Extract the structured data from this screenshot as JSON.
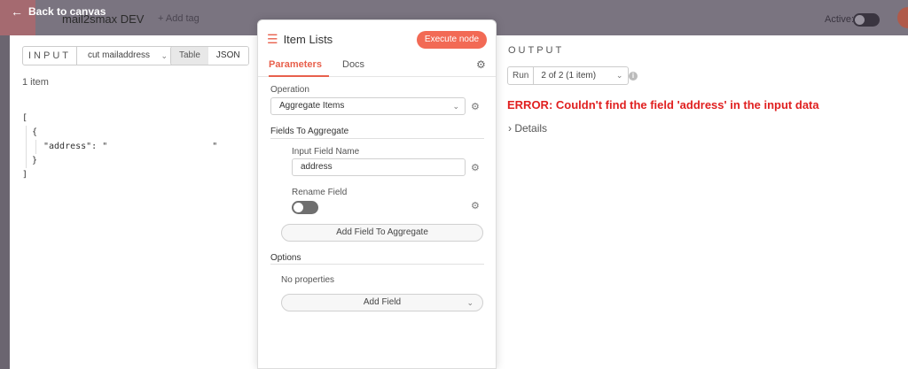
{
  "topbar": {
    "back_label": "Back to canvas",
    "workflow_name": "mail2smax DEV",
    "add_tag_label": "+ Add tag",
    "active_label": "Active:"
  },
  "input": {
    "label": "INPUT",
    "source_node": "cut mailaddress",
    "view_table": "Table",
    "view_json": "JSON",
    "active_view": "JSON",
    "item_count": "1 item",
    "json_key": "\"address\": \"",
    "json_value_end": "\""
  },
  "node": {
    "title": "Item Lists",
    "execute_label": "Execute node",
    "tabs": [
      "Parameters",
      "Docs"
    ],
    "active_tab": "Parameters",
    "operation_label": "Operation",
    "operation_value": "Aggregate Items",
    "fields_section": "Fields To Aggregate",
    "input_field_label": "Input Field Name",
    "input_field_value": "address",
    "rename_label": "Rename Field",
    "rename_enabled": false,
    "add_field_aggregate": "Add Field To Aggregate",
    "options_section": "Options",
    "no_properties": "No properties",
    "add_field": "Add Field"
  },
  "output": {
    "label": "OUTPUT",
    "run_label": "Run",
    "run_value": "2 of 2 (1 item)",
    "error": "ERROR: Couldn't find the field 'address' in the input data",
    "details_label": "Details"
  },
  "colors": {
    "accent": "#e8604c",
    "error": "#e02020"
  }
}
